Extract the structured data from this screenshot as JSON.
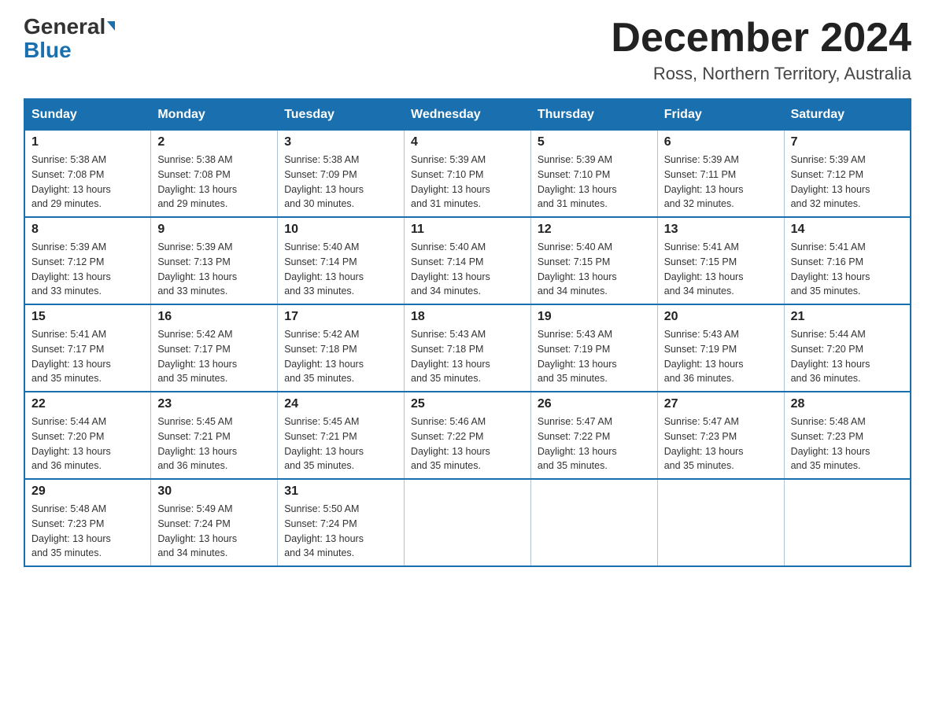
{
  "header": {
    "logo_general": "General",
    "logo_blue": "Blue",
    "month_title": "December 2024",
    "location": "Ross, Northern Territory, Australia"
  },
  "days_of_week": [
    "Sunday",
    "Monday",
    "Tuesday",
    "Wednesday",
    "Thursday",
    "Friday",
    "Saturday"
  ],
  "weeks": [
    [
      {
        "day": "1",
        "sunrise": "5:38 AM",
        "sunset": "7:08 PM",
        "daylight": "13 hours and 29 minutes."
      },
      {
        "day": "2",
        "sunrise": "5:38 AM",
        "sunset": "7:08 PM",
        "daylight": "13 hours and 29 minutes."
      },
      {
        "day": "3",
        "sunrise": "5:38 AM",
        "sunset": "7:09 PM",
        "daylight": "13 hours and 30 minutes."
      },
      {
        "day": "4",
        "sunrise": "5:39 AM",
        "sunset": "7:10 PM",
        "daylight": "13 hours and 31 minutes."
      },
      {
        "day": "5",
        "sunrise": "5:39 AM",
        "sunset": "7:10 PM",
        "daylight": "13 hours and 31 minutes."
      },
      {
        "day": "6",
        "sunrise": "5:39 AM",
        "sunset": "7:11 PM",
        "daylight": "13 hours and 32 minutes."
      },
      {
        "day": "7",
        "sunrise": "5:39 AM",
        "sunset": "7:12 PM",
        "daylight": "13 hours and 32 minutes."
      }
    ],
    [
      {
        "day": "8",
        "sunrise": "5:39 AM",
        "sunset": "7:12 PM",
        "daylight": "13 hours and 33 minutes."
      },
      {
        "day": "9",
        "sunrise": "5:39 AM",
        "sunset": "7:13 PM",
        "daylight": "13 hours and 33 minutes."
      },
      {
        "day": "10",
        "sunrise": "5:40 AM",
        "sunset": "7:14 PM",
        "daylight": "13 hours and 33 minutes."
      },
      {
        "day": "11",
        "sunrise": "5:40 AM",
        "sunset": "7:14 PM",
        "daylight": "13 hours and 34 minutes."
      },
      {
        "day": "12",
        "sunrise": "5:40 AM",
        "sunset": "7:15 PM",
        "daylight": "13 hours and 34 minutes."
      },
      {
        "day": "13",
        "sunrise": "5:41 AM",
        "sunset": "7:15 PM",
        "daylight": "13 hours and 34 minutes."
      },
      {
        "day": "14",
        "sunrise": "5:41 AM",
        "sunset": "7:16 PM",
        "daylight": "13 hours and 35 minutes."
      }
    ],
    [
      {
        "day": "15",
        "sunrise": "5:41 AM",
        "sunset": "7:17 PM",
        "daylight": "13 hours and 35 minutes."
      },
      {
        "day": "16",
        "sunrise": "5:42 AM",
        "sunset": "7:17 PM",
        "daylight": "13 hours and 35 minutes."
      },
      {
        "day": "17",
        "sunrise": "5:42 AM",
        "sunset": "7:18 PM",
        "daylight": "13 hours and 35 minutes."
      },
      {
        "day": "18",
        "sunrise": "5:43 AM",
        "sunset": "7:18 PM",
        "daylight": "13 hours and 35 minutes."
      },
      {
        "day": "19",
        "sunrise": "5:43 AM",
        "sunset": "7:19 PM",
        "daylight": "13 hours and 35 minutes."
      },
      {
        "day": "20",
        "sunrise": "5:43 AM",
        "sunset": "7:19 PM",
        "daylight": "13 hours and 36 minutes."
      },
      {
        "day": "21",
        "sunrise": "5:44 AM",
        "sunset": "7:20 PM",
        "daylight": "13 hours and 36 minutes."
      }
    ],
    [
      {
        "day": "22",
        "sunrise": "5:44 AM",
        "sunset": "7:20 PM",
        "daylight": "13 hours and 36 minutes."
      },
      {
        "day": "23",
        "sunrise": "5:45 AM",
        "sunset": "7:21 PM",
        "daylight": "13 hours and 36 minutes."
      },
      {
        "day": "24",
        "sunrise": "5:45 AM",
        "sunset": "7:21 PM",
        "daylight": "13 hours and 35 minutes."
      },
      {
        "day": "25",
        "sunrise": "5:46 AM",
        "sunset": "7:22 PM",
        "daylight": "13 hours and 35 minutes."
      },
      {
        "day": "26",
        "sunrise": "5:47 AM",
        "sunset": "7:22 PM",
        "daylight": "13 hours and 35 minutes."
      },
      {
        "day": "27",
        "sunrise": "5:47 AM",
        "sunset": "7:23 PM",
        "daylight": "13 hours and 35 minutes."
      },
      {
        "day": "28",
        "sunrise": "5:48 AM",
        "sunset": "7:23 PM",
        "daylight": "13 hours and 35 minutes."
      }
    ],
    [
      {
        "day": "29",
        "sunrise": "5:48 AM",
        "sunset": "7:23 PM",
        "daylight": "13 hours and 35 minutes."
      },
      {
        "day": "30",
        "sunrise": "5:49 AM",
        "sunset": "7:24 PM",
        "daylight": "13 hours and 34 minutes."
      },
      {
        "day": "31",
        "sunrise": "5:50 AM",
        "sunset": "7:24 PM",
        "daylight": "13 hours and 34 minutes."
      },
      null,
      null,
      null,
      null
    ]
  ],
  "labels": {
    "sunrise": "Sunrise: ",
    "sunset": "Sunset: ",
    "daylight": "Daylight: "
  }
}
